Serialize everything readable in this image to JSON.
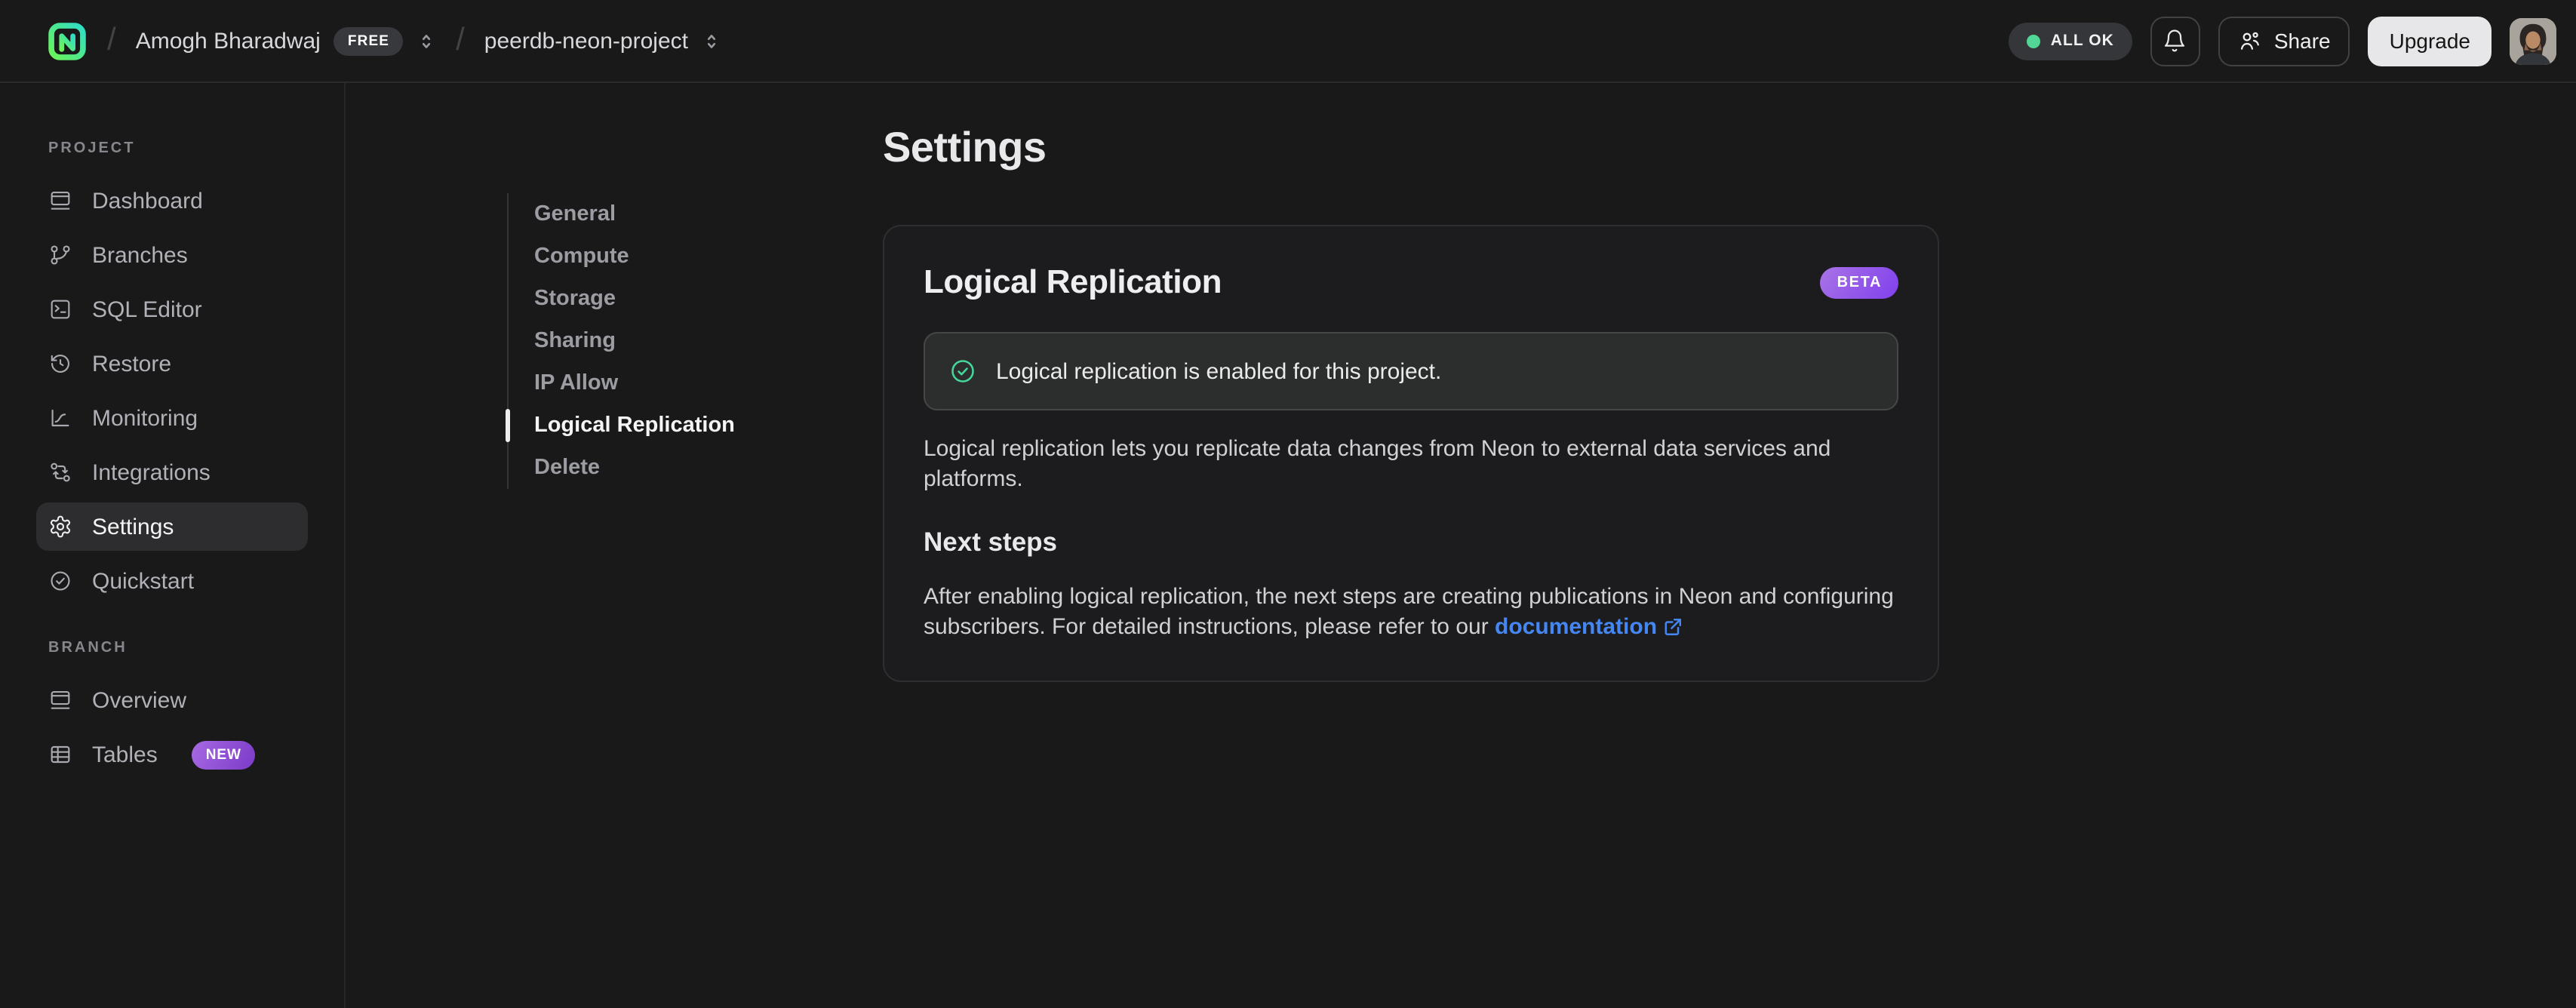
{
  "header": {
    "separator": "/",
    "org_name": "Amogh Bharadwaj",
    "org_plan_badge": "FREE",
    "project_name": "peerdb-neon-project",
    "status_badge": "ALL OK",
    "share_label": "Share",
    "upgrade_label": "Upgrade"
  },
  "sidebar": {
    "project_section": {
      "label": "PROJECT",
      "items": [
        {
          "label": "Dashboard"
        },
        {
          "label": "Branches"
        },
        {
          "label": "SQL Editor"
        },
        {
          "label": "Restore"
        },
        {
          "label": "Monitoring"
        },
        {
          "label": "Integrations"
        },
        {
          "label": "Settings",
          "active": true
        },
        {
          "label": "Quickstart"
        }
      ]
    },
    "branch_section": {
      "label": "BRANCH",
      "items": [
        {
          "label": "Overview"
        },
        {
          "label": "Tables",
          "badge": "NEW"
        }
      ]
    }
  },
  "settings_nav": {
    "items": [
      {
        "label": "General"
      },
      {
        "label": "Compute"
      },
      {
        "label": "Storage"
      },
      {
        "label": "Sharing"
      },
      {
        "label": "IP Allow"
      },
      {
        "label": "Logical Replication",
        "active": true
      },
      {
        "label": "Delete"
      }
    ]
  },
  "main": {
    "page_title": "Settings",
    "card": {
      "title": "Logical Replication",
      "beta_badge": "BETA",
      "banner_text": "Logical replication is enabled for this project.",
      "description": "Logical replication lets you replicate data changes from Neon to external data services and platforms.",
      "next_steps_title": "Next steps",
      "next_steps_text": "After enabling logical replication, the next steps are creating publications in Neon and configuring subscribers. For detailed instructions, please refer to our ",
      "doc_link_label": "documentation"
    }
  },
  "colors": {
    "background": "#191919",
    "card_background": "#1c1c1e",
    "banner_background": "#2c2e2d",
    "success_green": "#45d69a",
    "brand_green": "#00e599",
    "link_blue": "#4487f2",
    "badge_purple_start": "#a873e6",
    "badge_purple_end": "#8140ec"
  }
}
